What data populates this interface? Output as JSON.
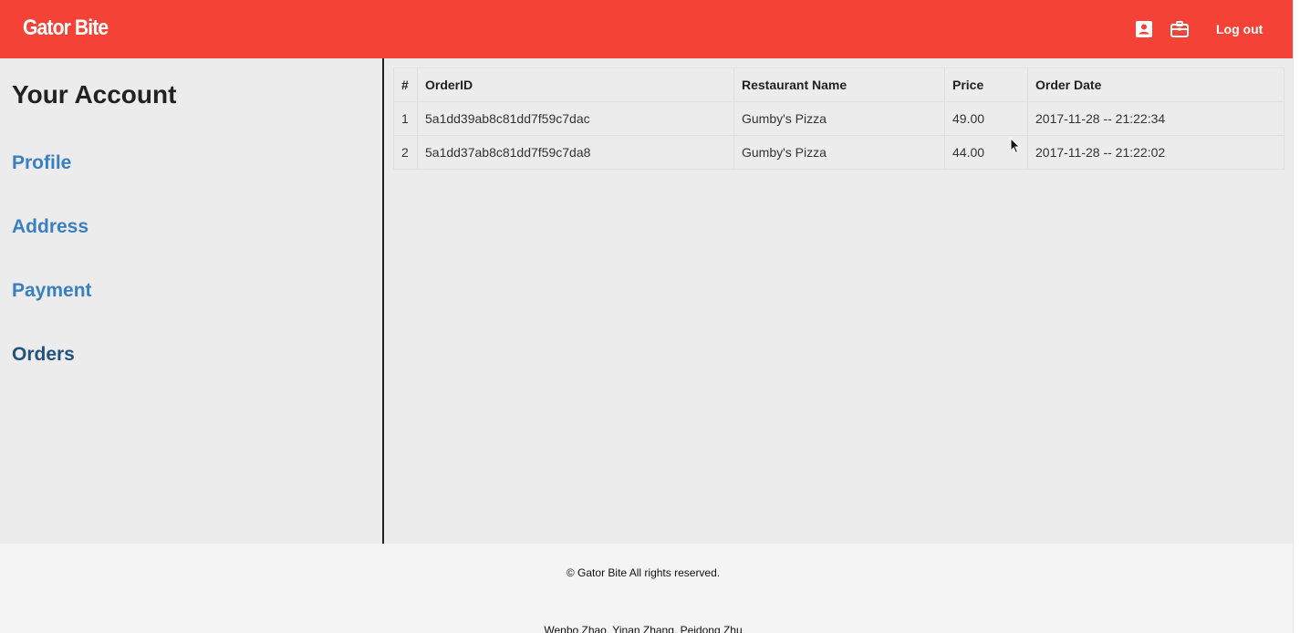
{
  "header": {
    "brand": "Gator Bite",
    "logout_label": "Log out",
    "background": "#f44336",
    "icons": [
      "contact-icon",
      "briefcase-icon"
    ]
  },
  "sidebar": {
    "title": "Your Account",
    "items": [
      {
        "label": "Profile",
        "active": false
      },
      {
        "label": "Address",
        "active": false
      },
      {
        "label": "Payment",
        "active": false
      },
      {
        "label": "Orders",
        "active": true
      }
    ],
    "link_color": "#3a7fc1",
    "active_color": "#23527c"
  },
  "orders_table": {
    "headers": [
      "#",
      "OrderID",
      "Restaurant Name",
      "Price",
      "Order Date"
    ],
    "rows": [
      {
        "index": "1",
        "order_id": "5a1dd39ab8c81dd7f59c7dac",
        "restaurant": "Gumby's Pizza",
        "price": "49.00",
        "date": "2017-11-28 -- 21:22:34"
      },
      {
        "index": "2",
        "order_id": "5a1dd37ab8c81dd7f59c7da8",
        "restaurant": "Gumby's Pizza",
        "price": "44.00",
        "date": "2017-11-28 -- 21:22:02"
      }
    ]
  },
  "footer": {
    "copyright": "© Gator Bite All rights reserved.",
    "authors": "Wenbo Zhao, Yinan Zhang, Peidong Zhu"
  }
}
